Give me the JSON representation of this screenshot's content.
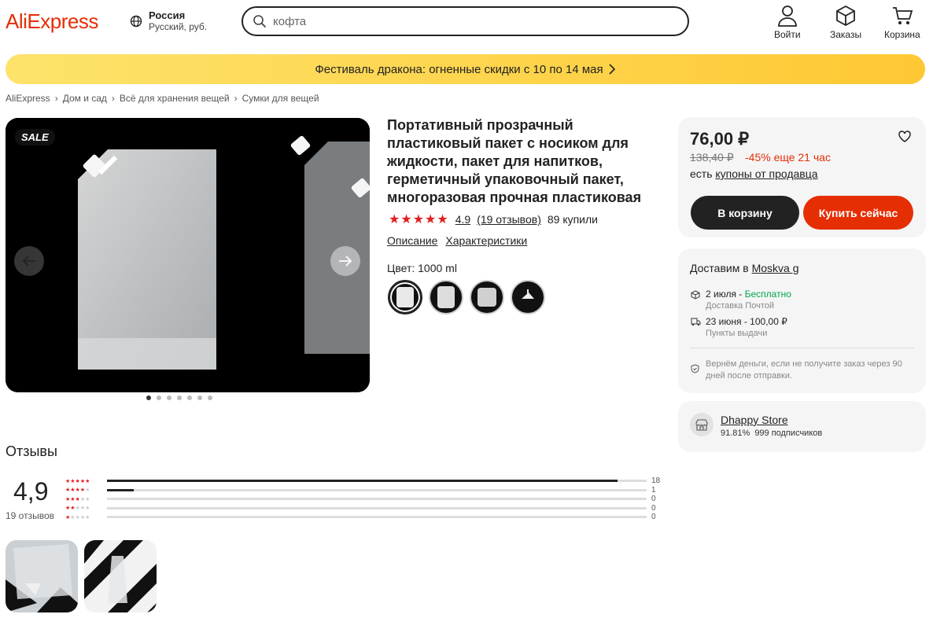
{
  "header": {
    "logo": "AliExpress",
    "region_country": "Россия",
    "region_lang": "Русский, руб.",
    "search_value": "кофта",
    "login": "Войти",
    "orders": "Заказы",
    "cart": "Корзина"
  },
  "banner": {
    "text": "Фестиваль дракона: огненные скидки с 10 по 14 мая"
  },
  "breadcrumb": [
    "AliExpress",
    "Дом и сад",
    "Всё для хранения вещей",
    "Сумки для вещей"
  ],
  "gallery": {
    "badge": "SALE",
    "dots": 7,
    "active_dot": 0
  },
  "product": {
    "title": "Портативный прозрачный пластиковый пакет с носиком для жидкости, пакет для напитков, герметичный упаковочный пакет, многоразовая прочная пластиковая",
    "rating": "4.9",
    "reviews_link": "(19 отзывов)",
    "sold": "89 купили",
    "tab_description": "Описание",
    "tab_specs": "Характеристики",
    "color_label": "Цвет: 1000 ml"
  },
  "buy": {
    "price": "76,00 ₽",
    "old_price": "138,40 ₽",
    "discount": "-45% еще 21 час",
    "coupon_prefix": "есть",
    "coupon_link": "купоны от продавца",
    "cart_button": "В корзину",
    "buy_button": "Купить сейчас"
  },
  "delivery": {
    "label": "Доставим в",
    "city": "Moskva g",
    "opt1_date": "2 июля - ",
    "opt1_free": "Бесплатно",
    "opt1_sub": "Доставка Почтой",
    "opt2": "23 июня - 100,00 ₽",
    "opt2_sub": "Пункты выдачи",
    "guarantee": "Вернём деньги, если не получите заказ через 90 дней после отправки."
  },
  "store": {
    "name": "Dhappy Store",
    "rating": "91.81%",
    "followers": "999 подписчиков"
  },
  "reviews": {
    "heading": "Отзывы",
    "score": "4,9",
    "count": "19 отзывов",
    "distribution": [
      {
        "stars": 5,
        "count": "18",
        "fraction": 0.946
      },
      {
        "stars": 4,
        "count": "1",
        "fraction": 0.05
      },
      {
        "stars": 3,
        "count": "0",
        "fraction": 0
      },
      {
        "stars": 2,
        "count": "0",
        "fraction": 0
      },
      {
        "stars": 1,
        "count": "0",
        "fraction": 0
      }
    ]
  },
  "colors": {
    "accent": "#e62e04",
    "cart_btn": "#222222",
    "buy_btn": "#e62e04",
    "banner": "#fdd94a"
  }
}
